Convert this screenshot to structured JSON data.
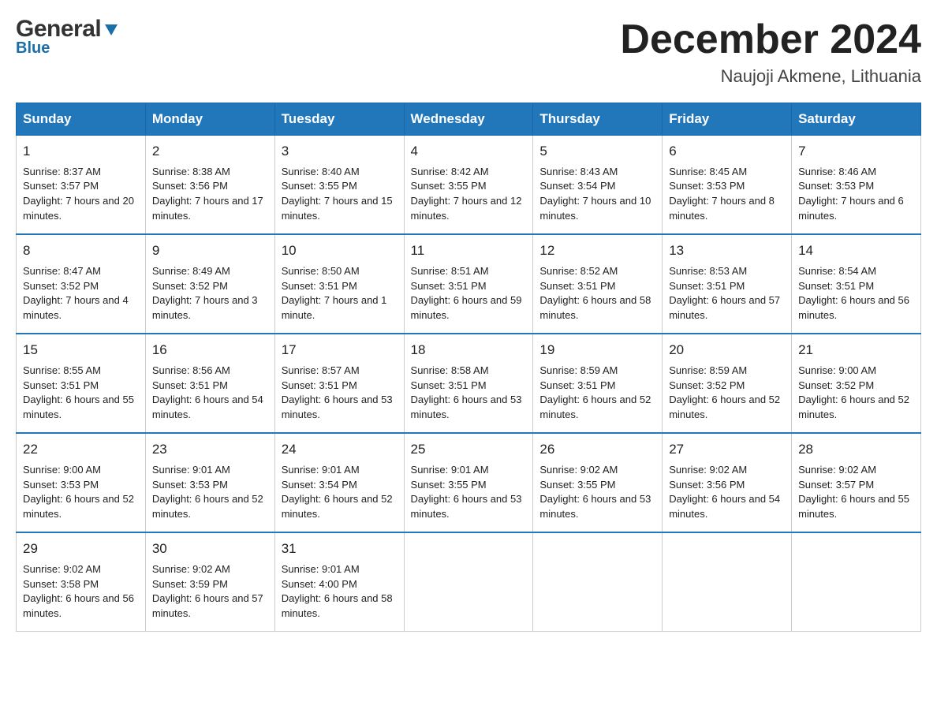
{
  "header": {
    "logo_general": "General",
    "logo_blue": "Blue",
    "main_title": "December 2024",
    "subtitle": "Naujoji Akmene, Lithuania"
  },
  "calendar": {
    "days_of_week": [
      "Sunday",
      "Monday",
      "Tuesday",
      "Wednesday",
      "Thursday",
      "Friday",
      "Saturday"
    ],
    "weeks": [
      [
        {
          "day": "1",
          "sunrise": "8:37 AM",
          "sunset": "3:57 PM",
          "daylight": "7 hours and 20 minutes."
        },
        {
          "day": "2",
          "sunrise": "8:38 AM",
          "sunset": "3:56 PM",
          "daylight": "7 hours and 17 minutes."
        },
        {
          "day": "3",
          "sunrise": "8:40 AM",
          "sunset": "3:55 PM",
          "daylight": "7 hours and 15 minutes."
        },
        {
          "day": "4",
          "sunrise": "8:42 AM",
          "sunset": "3:55 PM",
          "daylight": "7 hours and 12 minutes."
        },
        {
          "day": "5",
          "sunrise": "8:43 AM",
          "sunset": "3:54 PM",
          "daylight": "7 hours and 10 minutes."
        },
        {
          "day": "6",
          "sunrise": "8:45 AM",
          "sunset": "3:53 PM",
          "daylight": "7 hours and 8 minutes."
        },
        {
          "day": "7",
          "sunrise": "8:46 AM",
          "sunset": "3:53 PM",
          "daylight": "7 hours and 6 minutes."
        }
      ],
      [
        {
          "day": "8",
          "sunrise": "8:47 AM",
          "sunset": "3:52 PM",
          "daylight": "7 hours and 4 minutes."
        },
        {
          "day": "9",
          "sunrise": "8:49 AM",
          "sunset": "3:52 PM",
          "daylight": "7 hours and 3 minutes."
        },
        {
          "day": "10",
          "sunrise": "8:50 AM",
          "sunset": "3:51 PM",
          "daylight": "7 hours and 1 minute."
        },
        {
          "day": "11",
          "sunrise": "8:51 AM",
          "sunset": "3:51 PM",
          "daylight": "6 hours and 59 minutes."
        },
        {
          "day": "12",
          "sunrise": "8:52 AM",
          "sunset": "3:51 PM",
          "daylight": "6 hours and 58 minutes."
        },
        {
          "day": "13",
          "sunrise": "8:53 AM",
          "sunset": "3:51 PM",
          "daylight": "6 hours and 57 minutes."
        },
        {
          "day": "14",
          "sunrise": "8:54 AM",
          "sunset": "3:51 PM",
          "daylight": "6 hours and 56 minutes."
        }
      ],
      [
        {
          "day": "15",
          "sunrise": "8:55 AM",
          "sunset": "3:51 PM",
          "daylight": "6 hours and 55 minutes."
        },
        {
          "day": "16",
          "sunrise": "8:56 AM",
          "sunset": "3:51 PM",
          "daylight": "6 hours and 54 minutes."
        },
        {
          "day": "17",
          "sunrise": "8:57 AM",
          "sunset": "3:51 PM",
          "daylight": "6 hours and 53 minutes."
        },
        {
          "day": "18",
          "sunrise": "8:58 AM",
          "sunset": "3:51 PM",
          "daylight": "6 hours and 53 minutes."
        },
        {
          "day": "19",
          "sunrise": "8:59 AM",
          "sunset": "3:51 PM",
          "daylight": "6 hours and 52 minutes."
        },
        {
          "day": "20",
          "sunrise": "8:59 AM",
          "sunset": "3:52 PM",
          "daylight": "6 hours and 52 minutes."
        },
        {
          "day": "21",
          "sunrise": "9:00 AM",
          "sunset": "3:52 PM",
          "daylight": "6 hours and 52 minutes."
        }
      ],
      [
        {
          "day": "22",
          "sunrise": "9:00 AM",
          "sunset": "3:53 PM",
          "daylight": "6 hours and 52 minutes."
        },
        {
          "day": "23",
          "sunrise": "9:01 AM",
          "sunset": "3:53 PM",
          "daylight": "6 hours and 52 minutes."
        },
        {
          "day": "24",
          "sunrise": "9:01 AM",
          "sunset": "3:54 PM",
          "daylight": "6 hours and 52 minutes."
        },
        {
          "day": "25",
          "sunrise": "9:01 AM",
          "sunset": "3:55 PM",
          "daylight": "6 hours and 53 minutes."
        },
        {
          "day": "26",
          "sunrise": "9:02 AM",
          "sunset": "3:55 PM",
          "daylight": "6 hours and 53 minutes."
        },
        {
          "day": "27",
          "sunrise": "9:02 AM",
          "sunset": "3:56 PM",
          "daylight": "6 hours and 54 minutes."
        },
        {
          "day": "28",
          "sunrise": "9:02 AM",
          "sunset": "3:57 PM",
          "daylight": "6 hours and 55 minutes."
        }
      ],
      [
        {
          "day": "29",
          "sunrise": "9:02 AM",
          "sunset": "3:58 PM",
          "daylight": "6 hours and 56 minutes."
        },
        {
          "day": "30",
          "sunrise": "9:02 AM",
          "sunset": "3:59 PM",
          "daylight": "6 hours and 57 minutes."
        },
        {
          "day": "31",
          "sunrise": "9:01 AM",
          "sunset": "4:00 PM",
          "daylight": "6 hours and 58 minutes."
        },
        null,
        null,
        null,
        null
      ]
    ]
  },
  "labels": {
    "sunrise": "Sunrise: ",
    "sunset": "Sunset: ",
    "daylight": "Daylight: "
  }
}
